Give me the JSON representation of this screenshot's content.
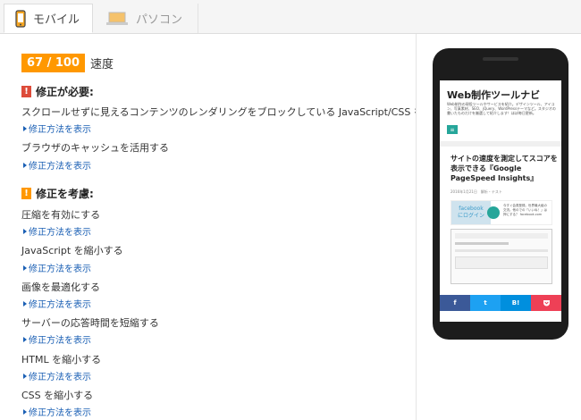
{
  "tabs": [
    {
      "label": "モバイル",
      "icon": "smartphone-icon",
      "active": true
    },
    {
      "label": "パソコン",
      "icon": "laptop-icon",
      "active": false
    }
  ],
  "score": {
    "value": "67 / 100",
    "label": "速度",
    "color": "#ff9800"
  },
  "must_fix": {
    "title": "修正が必要:",
    "icon": "!",
    "rules": [
      {
        "text": "スクロールせずに見えるコンテンツのレンダリングをブロックしている JavaScript/CSS を排除する",
        "howto": "修正方法を表示"
      },
      {
        "text": "ブラウザのキャッシュを活用する",
        "howto": "修正方法を表示"
      }
    ]
  },
  "consider_fix": {
    "title": "修正を考慮:",
    "icon": "!",
    "rules": [
      {
        "text": "圧縮を有効にする",
        "howto": "修正方法を表示"
      },
      {
        "text": "JavaScript を縮小する",
        "howto": "修正方法を表示"
      },
      {
        "text": "画像を最適化する",
        "howto": "修正方法を表示"
      },
      {
        "text": "サーバーの応答時間を短縮する",
        "howto": "修正方法を表示"
      },
      {
        "text": "HTML を縮小する",
        "howto": "修正方法を表示"
      },
      {
        "text": "CSS を縮小する",
        "howto": "修正方法を表示"
      }
    ]
  },
  "preview": {
    "site_title": "Web制作ツールナビ",
    "site_desc": "Web制作の現役ツールやサービスを紹介。デザインツール、アイコン、写真素材、SEO、jQuery、WordPressテーマなど。スタジオの書いたものだけを厳選して紹介します！ほぼ毎日更新。",
    "menu_icon": "≡",
    "post_title": "サイトの速度を測定してスコアを表示できる『Google PageSpeed Insights』",
    "post_meta": "2016年1月21日　解析・テスト",
    "fb_left": "facebook\nにログイン",
    "fb_right": "今すぐ会員登録。世界最大級の交流。他のでの「いいね！」は押にする？ facebook.com",
    "share": [
      "f",
      "t",
      "B!",
      "pocket"
    ],
    "share_colors": [
      "#3b5998",
      "#1da1f2",
      "#008fde",
      "#ee4056"
    ]
  }
}
